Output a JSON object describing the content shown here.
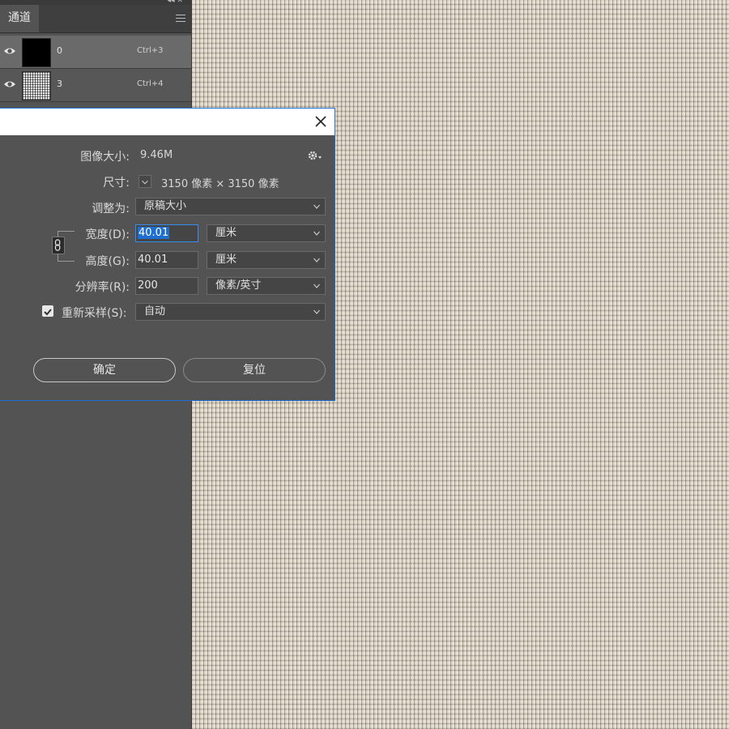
{
  "channels_panel": {
    "tab_label": "通道",
    "channels": [
      {
        "name": "0",
        "shortcut": "Ctrl+3"
      },
      {
        "name": "3",
        "shortcut": "Ctrl+4"
      }
    ]
  },
  "image_size_dialog": {
    "image_size_label": "图像大小:",
    "image_size_value": "9.46M",
    "dimensions_label": "尺寸:",
    "dimensions_value": "3150 像素 × 3150 像素",
    "fit_to_label": "调整为:",
    "fit_to_value": "原稿大小",
    "width_label": "宽度(D):",
    "width_value": "40.01",
    "width_unit": "厘米",
    "height_label": "高度(G):",
    "height_value": "40.01",
    "height_unit": "厘米",
    "resolution_label": "分辨率(R):",
    "resolution_value": "200",
    "resolution_unit": "像素/英寸",
    "resample_label": "重新采样(S):",
    "resample_checked": true,
    "resample_value": "自动",
    "ok_label": "确定",
    "reset_label": "复位"
  },
  "colors": {
    "accent": "#1e6fd0",
    "panel_bg": "#535353"
  }
}
